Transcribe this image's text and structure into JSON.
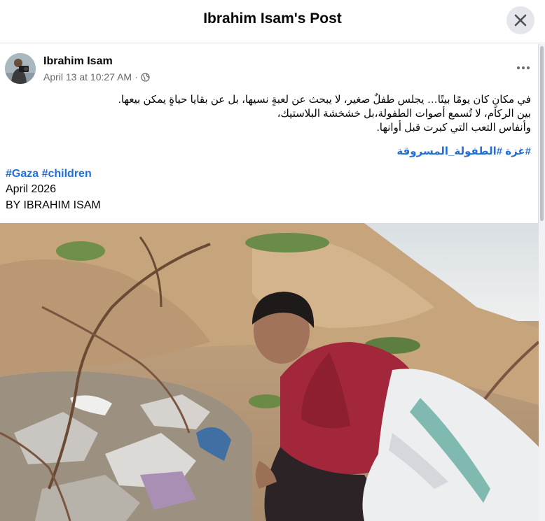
{
  "dialog": {
    "title": "Ibrahim Isam's Post"
  },
  "post": {
    "author": "Ibrahim Isam",
    "timestamp": "April 13 at 10:27 AM",
    "separator": "·",
    "privacy_icon": "globe-icon",
    "more_icon": "more-options-icon",
    "body_lines": [
      "في مكانٍ كان يومًا بيتًا… يجلس طفلٌ صغير، لا يبحث عن لعبةٍ نسيها، بل عن بقايا حياةٍ يمكن بيعها.",
      "بين الركام، لا تُسمع أصوات الطفولة،بل خشخشة البلاستيك،",
      "وأنفاس التعب التي كبرت قبل أوانها."
    ],
    "rtl_hashtags": "#غزة #الطفولة_المسروقة",
    "hashtags": [
      "#Gaza",
      "#children"
    ],
    "caption_date": "April 2026",
    "caption_byline": "BY IBRAHIM ISAM"
  },
  "colors": {
    "link": "#216fdb",
    "secondary_text": "#65676b",
    "close_bg": "#e4e6eb"
  }
}
